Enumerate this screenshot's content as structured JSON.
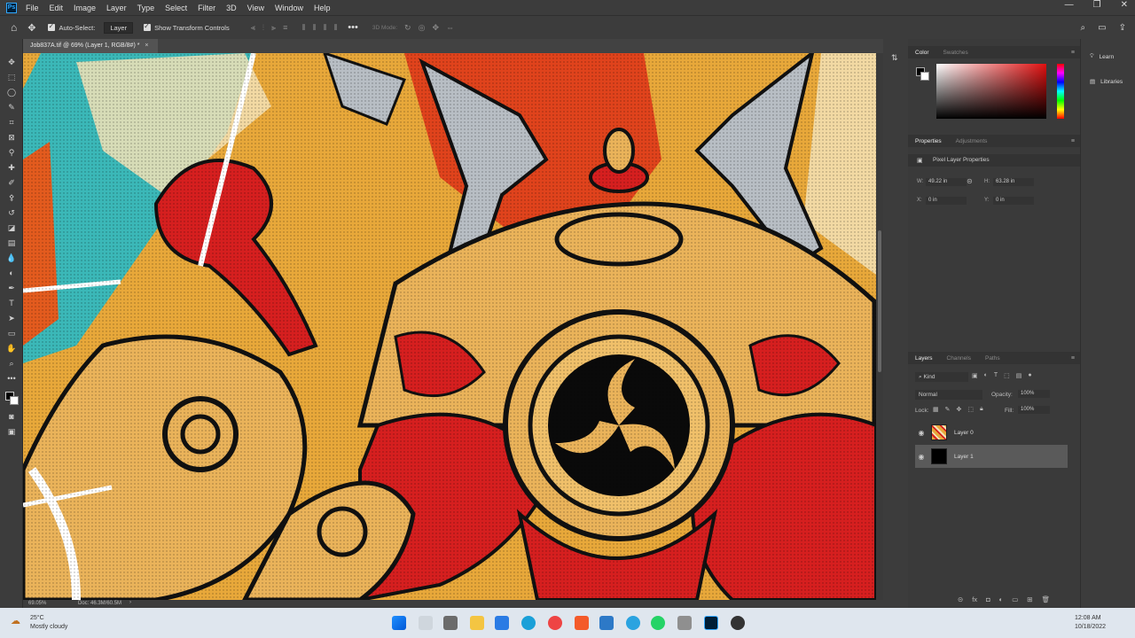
{
  "menu": {
    "logo": "Ps",
    "items": [
      "File",
      "Edit",
      "Image",
      "Layer",
      "Type",
      "Select",
      "Filter",
      "3D",
      "View",
      "Window",
      "Help"
    ]
  },
  "options_bar": {
    "auto_select_label": "Auto-Select:",
    "auto_select_target": "Layer",
    "show_transform_label": "Show Transform Controls",
    "mode_3d_label": "3D Mode:"
  },
  "document": {
    "tab_title": "Job837A.tif @ 69% (Layer 1, RGB/8#) *",
    "zoom": "69.05%",
    "doc_size": "Doc: 46.3M/60.5M"
  },
  "panels": {
    "color_tabs": [
      "Color",
      "Swatches"
    ],
    "properties_tabs": [
      "Properties",
      "Adjustments"
    ],
    "properties_title": "Pixel Layer Properties",
    "w_label": "W:",
    "w_value": "49.22 in",
    "h_label": "H:",
    "h_value": "63.28 in",
    "x_label": "X:",
    "x_value": "0 in",
    "y_label": "Y:",
    "y_value": "0 in",
    "layers_tabs": [
      "Layers",
      "Channels",
      "Paths"
    ],
    "kind_filter": "Kind",
    "blend_mode": "Normal",
    "opacity_label": "Opacity:",
    "opacity_value": "100%",
    "lock_label": "Lock:",
    "fill_label": "Fill:",
    "fill_value": "100%",
    "layers": [
      {
        "name": "Layer 0",
        "selected": false
      },
      {
        "name": "Layer 1",
        "selected": true
      }
    ]
  },
  "far_panel": {
    "learn": "Learn",
    "libraries": "Libraries"
  },
  "taskbar": {
    "weather_temp": "25°C",
    "weather_desc": "Mostly cloudy",
    "time": "12:08 AM",
    "date": "10/18/2022"
  },
  "colors": {
    "ui_dark": "#3c3c3c",
    "canvas_orange": "#e8a83a",
    "accent_red": "#d61f1f",
    "accent_teal": "#3bb8b8"
  }
}
